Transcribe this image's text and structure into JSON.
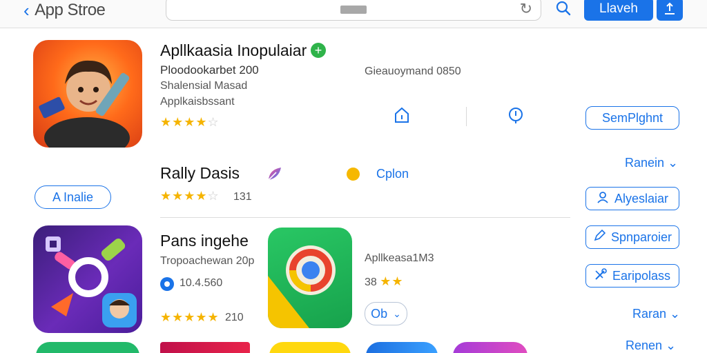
{
  "header": {
    "back_label": "App Stroe",
    "primary_button": "Llaveh",
    "share_icon": "share-icon",
    "search_icon": "search-icon",
    "reload_icon": "reload-icon"
  },
  "app1": {
    "title": "Apllkaasia Inopulaiar",
    "developer": "Ploodookarbet 200",
    "category": "Shalensial Masad",
    "subcategory": "Applkaisbssant",
    "stars": "★★★★",
    "stars_off": "☆",
    "info": "Gieauoymand 0850",
    "button": "SemPlghnt"
  },
  "app2": {
    "title": "Rally Dasis",
    "stars": "★★★★",
    "stars_off": "☆",
    "rating_count": "131",
    "option_label": "Cplon",
    "pill": "A Inalie",
    "ranking": "Ranein",
    "button": "Alyeslaiar"
  },
  "app3": {
    "title": "Pans ingehe",
    "developer": "Tropoachewan 20p",
    "size": "10.4.560",
    "stars": "★★★★★",
    "rating_count": "210",
    "button": "Spnparoier"
  },
  "app4": {
    "title": "Apllkeasa1M3",
    "rating_count": "38",
    "stars": "★★",
    "button": "Ob",
    "side_button": "Earipolass",
    "ranking": "Raran"
  },
  "bottom": {
    "ranking": "Renen"
  },
  "colors": {
    "accent": "#1a73e8",
    "star": "#f5b400",
    "verified": "#2fb34a"
  }
}
